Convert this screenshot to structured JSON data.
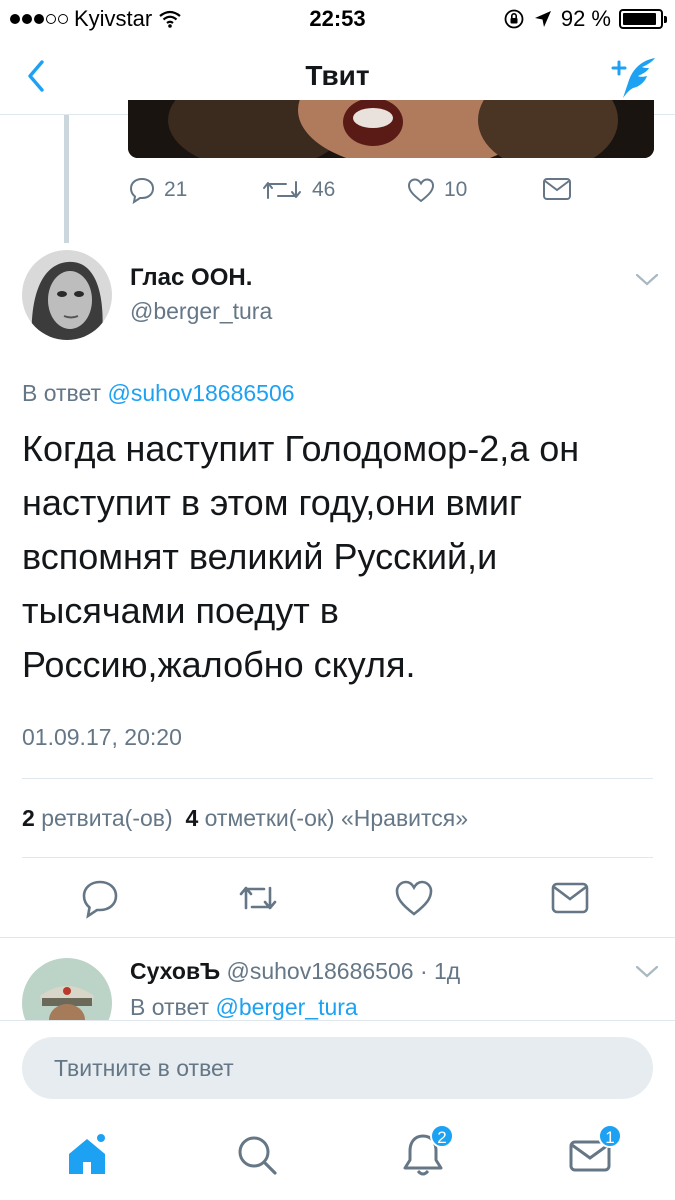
{
  "status_bar": {
    "carrier": "Kyivstar",
    "time": "22:53",
    "battery": "92 %",
    "battery_level": 0.92
  },
  "nav": {
    "title": "Твит"
  },
  "previous_tweet": {
    "reply_count": "21",
    "retweet_count": "46",
    "like_count": "10"
  },
  "tweet": {
    "author_name": "Глас ООН.",
    "author_handle": "@berger_tura",
    "reply_prefix": "В ответ",
    "reply_to": "@suhov18686506",
    "text_lines": [
      "Когда наступит Голодомор-2,а он",
      "наступит в этом году,они вмиг",
      "вспомнят великий Русский,и",
      "тысячами поедут в",
      "Россию,жалобно скуля."
    ],
    "timestamp": "01.09.17, 20:20",
    "retweets_count": "2",
    "retweets_label": "ретвита(-ов)",
    "likes_count": "4",
    "likes_label": "отметки(-ок) «Нравится»"
  },
  "reply": {
    "author_name": "СуховЪ",
    "author_handle": "@suhov18686506",
    "separator": "·",
    "age": "1д",
    "reply_prefix": "В ответ",
    "reply_to": "@berger_tura"
  },
  "composer": {
    "placeholder": "Твитните в ответ"
  },
  "tab_bar": {
    "notifications_badge": "2",
    "messages_badge": "1"
  },
  "colors": {
    "accent": "#1da1f2",
    "secondary_text": "#657786",
    "divider": "#e1e8ed"
  }
}
